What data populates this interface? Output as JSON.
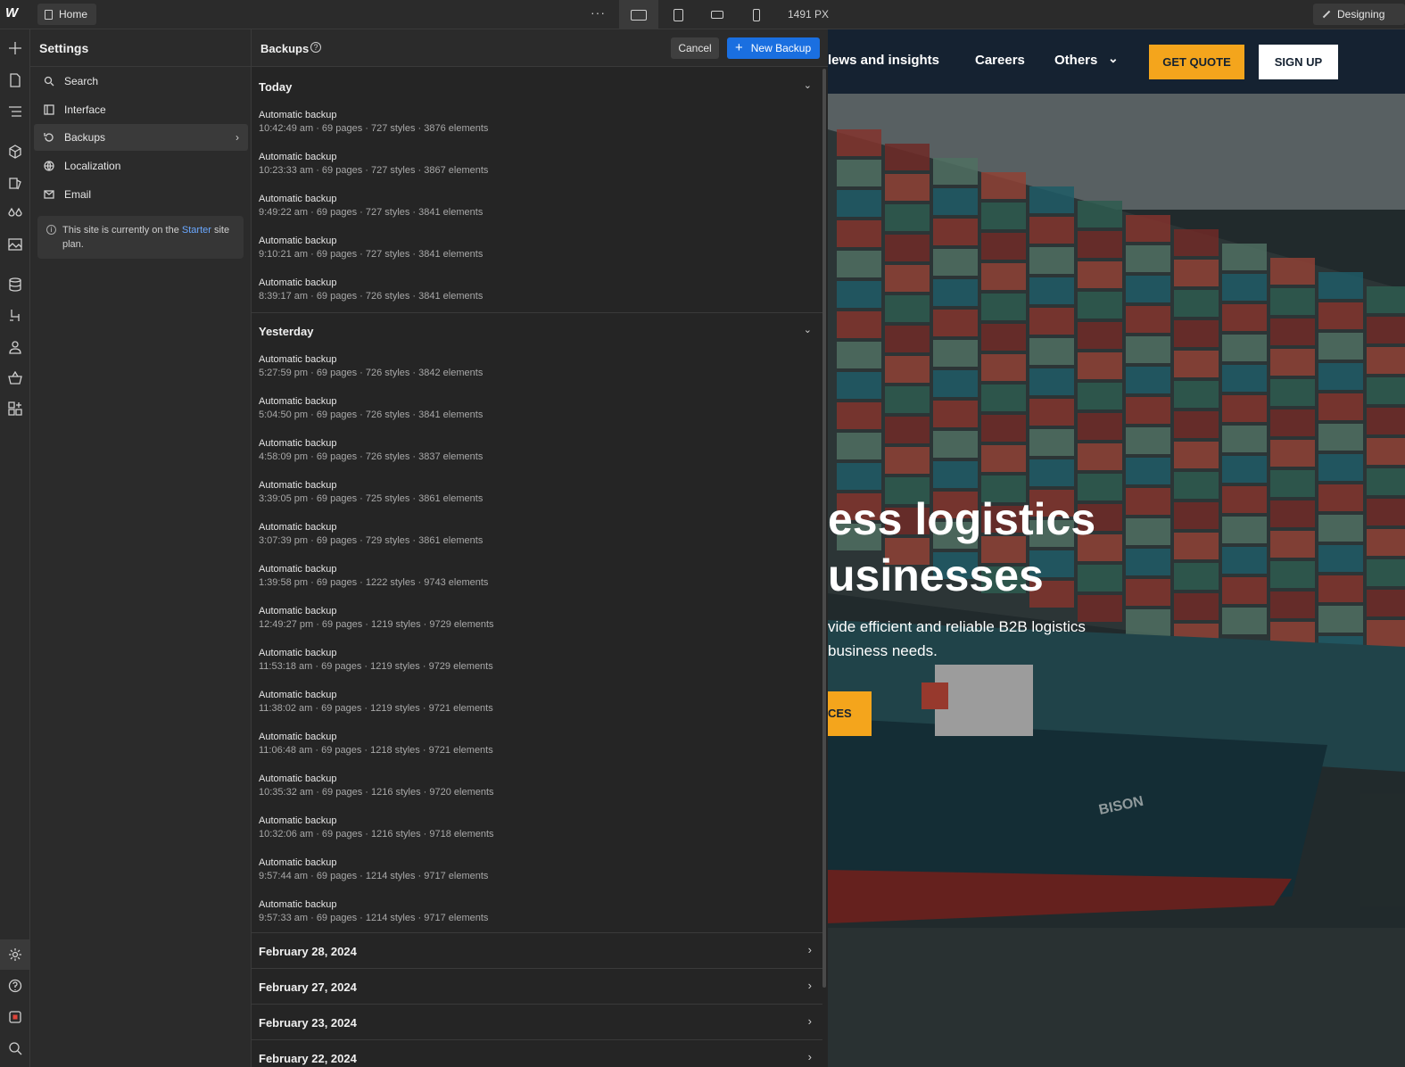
{
  "topbar": {
    "logo": "W",
    "page_name": "Home",
    "more": "···",
    "width_label": "1491 PX",
    "mode": "Designing"
  },
  "settings": {
    "title": "Settings",
    "items": [
      {
        "label": "Search",
        "icon": "search-icon"
      },
      {
        "label": "Interface",
        "icon": "interface-icon"
      },
      {
        "label": "Backups",
        "icon": "backups-icon"
      },
      {
        "label": "Localization",
        "icon": "globe-icon"
      },
      {
        "label": "Email",
        "icon": "mail-icon"
      }
    ],
    "plan_text_1": "This site is currently on the",
    "plan_link": "Starter",
    "plan_text_2": "site plan."
  },
  "backups": {
    "title": "Backups",
    "help": "?",
    "cancel_label": "Cancel",
    "new_label": "New Backup",
    "today": {
      "label": "Today",
      "entries": [
        {
          "title": "Automatic backup",
          "meta": "10:42:49 am · 69 pages · 727 styles · 3876 elements"
        },
        {
          "title": "Automatic backup",
          "meta": "10:23:33 am · 69 pages · 727 styles · 3867 elements"
        },
        {
          "title": "Automatic backup",
          "meta": "9:49:22 am · 69 pages · 727 styles · 3841 elements"
        },
        {
          "title": "Automatic backup",
          "meta": "9:10:21 am · 69 pages · 727 styles · 3841 elements"
        },
        {
          "title": "Automatic backup",
          "meta": "8:39:17 am · 69 pages · 726 styles · 3841 elements"
        }
      ]
    },
    "yesterday": {
      "label": "Yesterday",
      "entries": [
        {
          "title": "Automatic backup",
          "meta": "5:27:59 pm · 69 pages · 726 styles · 3842 elements"
        },
        {
          "title": "Automatic backup",
          "meta": "5:04:50 pm · 69 pages · 726 styles · 3841 elements"
        },
        {
          "title": "Automatic backup",
          "meta": "4:58:09 pm · 69 pages · 726 styles · 3837 elements"
        },
        {
          "title": "Automatic backup",
          "meta": "3:39:05 pm · 69 pages · 725 styles · 3861 elements"
        },
        {
          "title": "Automatic backup",
          "meta": "3:07:39 pm · 69 pages · 729 styles · 3861 elements"
        },
        {
          "title": "Automatic backup",
          "meta": "1:39:58 pm · 69 pages · 1222 styles · 9743 elements"
        },
        {
          "title": "Automatic backup",
          "meta": "12:49:27 pm · 69 pages · 1219 styles · 9729 elements"
        },
        {
          "title": "Automatic backup",
          "meta": "11:53:18 am · 69 pages · 1219 styles · 9729 elements"
        },
        {
          "title": "Automatic backup",
          "meta": "11:38:02 am · 69 pages · 1219 styles · 9721 elements"
        },
        {
          "title": "Automatic backup",
          "meta": "11:06:48 am · 69 pages · 1218 styles · 9721 elements"
        },
        {
          "title": "Automatic backup",
          "meta": "10:35:32 am · 69 pages · 1216 styles · 9720 elements"
        },
        {
          "title": "Automatic backup",
          "meta": "10:32:06 am · 69 pages · 1216 styles · 9718 elements"
        },
        {
          "title": "Automatic backup",
          "meta": "9:57:44 am · 69 pages · 1214 styles · 9717 elements"
        },
        {
          "title": "Automatic backup",
          "meta": "9:57:33 am · 69 pages · 1214 styles · 9717 elements"
        }
      ]
    },
    "collapsed_groups": [
      {
        "label": "February 28, 2024"
      },
      {
        "label": "February 27, 2024"
      },
      {
        "label": "February 23, 2024"
      },
      {
        "label": "February 22, 2024"
      }
    ]
  },
  "preview": {
    "nav": [
      {
        "label": "lews and insights"
      },
      {
        "label": "Careers"
      },
      {
        "label": "Others"
      }
    ],
    "quote_label": "GET QUOTE",
    "signup_label": "SIGN UP",
    "hero_line1": "ess logistics",
    "hero_line2": "usinesses",
    "sub_line1": "vide efficient and reliable B2B logistics",
    "sub_line2": "business needs.",
    "cta_label": "CES",
    "ship_text": "BISON",
    "accent": "#f4a51c",
    "nav_bg": "#152231"
  },
  "colors": {
    "ui_bg": "#2b2b2b",
    "primary": "#1a6fe0"
  }
}
